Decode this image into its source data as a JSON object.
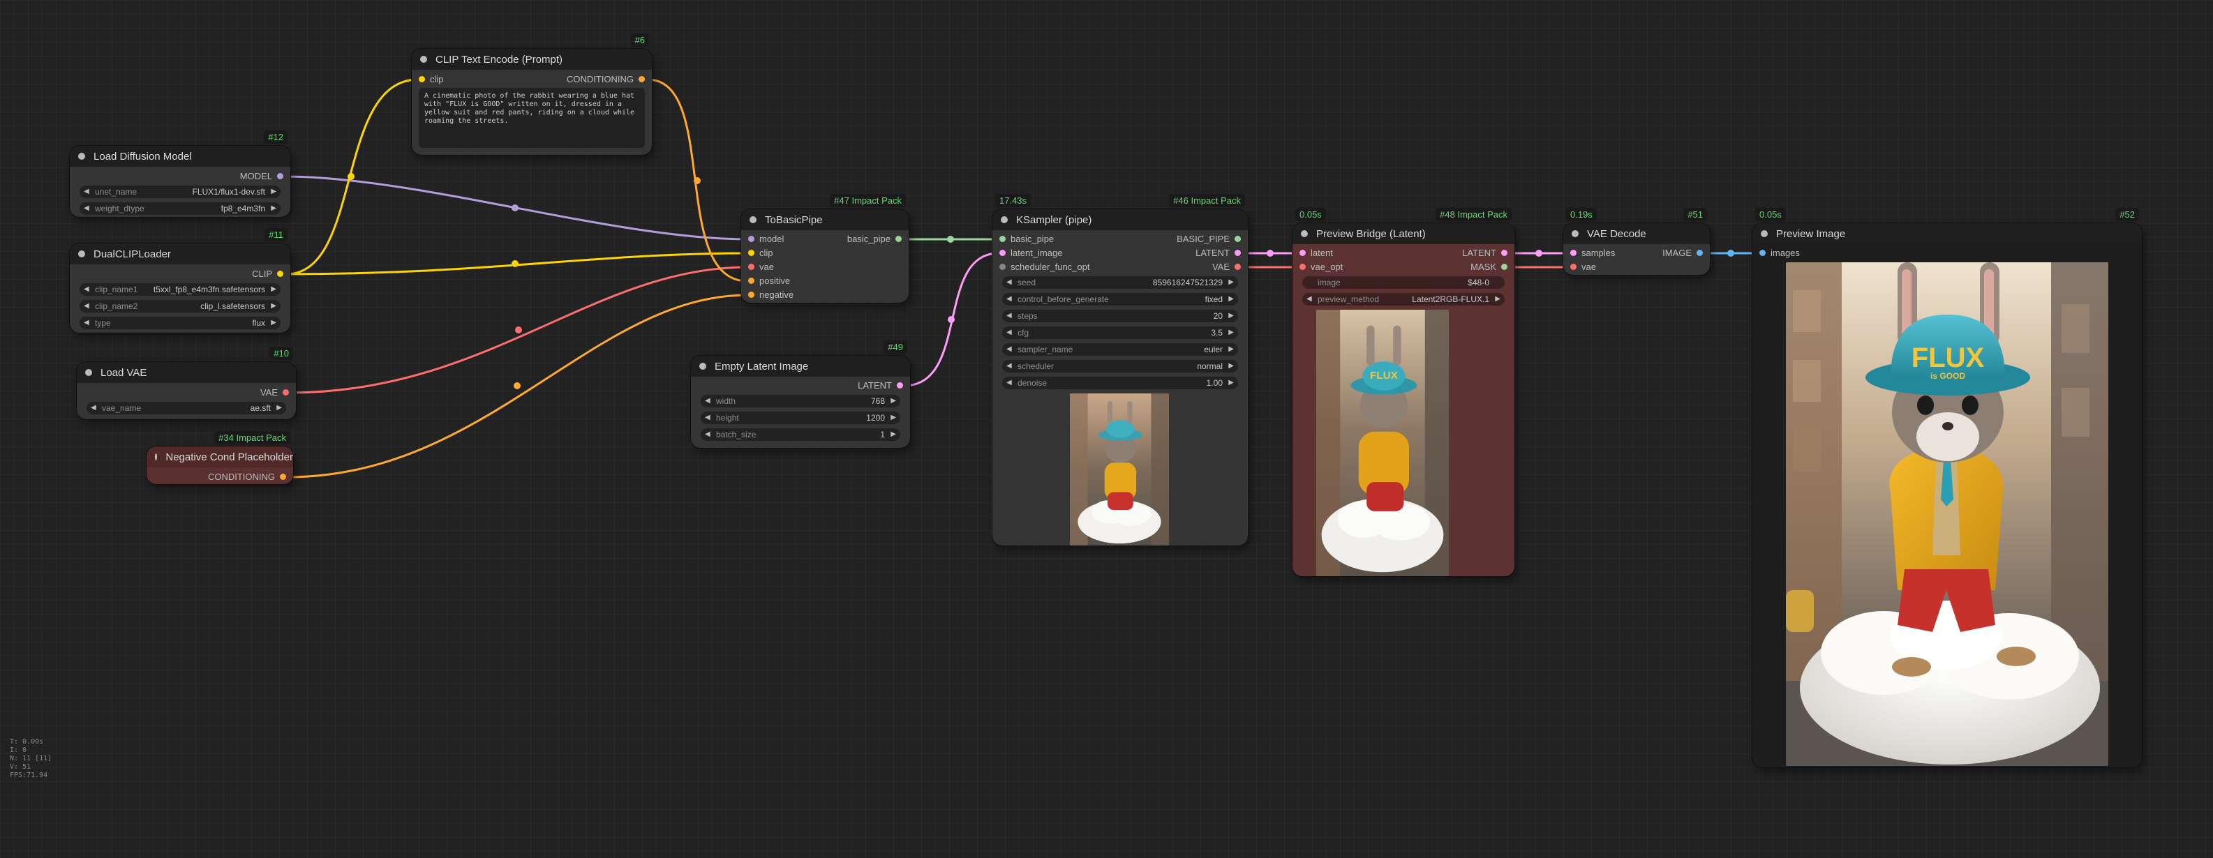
{
  "colors": {
    "model": "#b39ddb",
    "clip": "#ffd500",
    "vae": "#ff6e6e",
    "conditioning": "#ffa931",
    "latent": "#ff9cf9",
    "image": "#64b5f6",
    "basic_pipe": "#9bd59b",
    "default": "#888888"
  },
  "nodes": {
    "clip_text_encode": {
      "badge": "#6",
      "title": "CLIP Text Encode (Prompt)",
      "input_clip": "clip",
      "output_conditioning": "CONDITIONING",
      "prompt": "A cinematic photo of the rabbit wearing a blue hat with \"FLUX is GOOD\" written on it, dressed in a yellow suit and red pants, riding on a cloud while roaming the streets."
    },
    "load_diffusion_model": {
      "badge": "#12",
      "title": "Load Diffusion Model",
      "output_model": "MODEL",
      "unet_name_label": "unet_name",
      "unet_name_value": "FLUX1/flux1-dev.sft",
      "weight_dtype_label": "weight_dtype",
      "weight_dtype_value": "fp8_e4m3fn"
    },
    "dual_clip_loader": {
      "badge": "#11",
      "title": "DualCLIPLoader",
      "output_clip": "CLIP",
      "clip_name1_label": "clip_name1",
      "clip_name1_value": "t5xxl_fp8_e4m3fn.safetensors",
      "clip_name2_label": "clip_name2",
      "clip_name2_value": "clip_l.safetensors",
      "type_label": "type",
      "type_value": "flux"
    },
    "load_vae": {
      "badge": "#10",
      "title": "Load VAE",
      "output_vae": "VAE",
      "vae_name_label": "vae_name",
      "vae_name_value": "ae.sft"
    },
    "negative_cond": {
      "badge": "#34 Impact Pack",
      "title": "Negative Cond Placeholder",
      "output_conditioning": "CONDITIONING"
    },
    "to_basic_pipe": {
      "badge": "#47 Impact Pack",
      "title": "ToBasicPipe",
      "in_model": "model",
      "in_clip": "clip",
      "in_vae": "vae",
      "in_positive": "positive",
      "in_negative": "negative",
      "out_basic_pipe": "basic_pipe"
    },
    "empty_latent": {
      "badge": "#49",
      "title": "Empty Latent Image",
      "output_latent": "LATENT",
      "width_label": "width",
      "width_value": "768",
      "height_label": "height",
      "height_value": "1200",
      "batch_label": "batch_size",
      "batch_value": "1"
    },
    "ksampler": {
      "time": "17.43s",
      "badge": "#46 Impact Pack",
      "title": "KSampler (pipe)",
      "in_basic_pipe": "basic_pipe",
      "in_latent_image": "latent_image",
      "in_scheduler_func_opt": "scheduler_func_opt",
      "out_basic_pipe": "BASIC_PIPE",
      "out_latent": "LATENT",
      "out_vae": "VAE",
      "seed_label": "seed",
      "seed_value": "859616247521329",
      "control_label": "control_before_generate",
      "control_value": "fixed",
      "steps_label": "steps",
      "steps_value": "20",
      "cfg_label": "cfg",
      "cfg_value": "3.5",
      "sampler_label": "sampler_name",
      "sampler_value": "euler",
      "scheduler_label": "scheduler",
      "scheduler_value": "normal",
      "denoise_label": "denoise",
      "denoise_value": "1.00"
    },
    "preview_bridge": {
      "time": "0.05s",
      "badge": "#48 Impact Pack",
      "title": "Preview Bridge (Latent)",
      "in_latent": "latent",
      "in_vae_opt": "vae_opt",
      "out_latent": "LATENT",
      "out_mask": "MASK",
      "image_label": "image",
      "image_value": "$48-0",
      "preview_method_label": "preview_method",
      "preview_method_value": "Latent2RGB-FLUX.1"
    },
    "vae_decode": {
      "time": "0.19s",
      "badge": "#51",
      "title": "VAE Decode",
      "in_samples": "samples",
      "in_vae": "vae",
      "out_image": "IMAGE"
    },
    "preview_image": {
      "time": "0.05s",
      "badge": "#52",
      "title": "Preview Image",
      "in_images": "images",
      "hat_text_main": "FLUX",
      "hat_text_sub": "is GOOD"
    }
  },
  "stats": {
    "line1": "T: 0.00s",
    "line2": "I: 0",
    "line3": "N: 11 [11]",
    "line4": "V: 51",
    "line5": "FPS:71.94"
  }
}
